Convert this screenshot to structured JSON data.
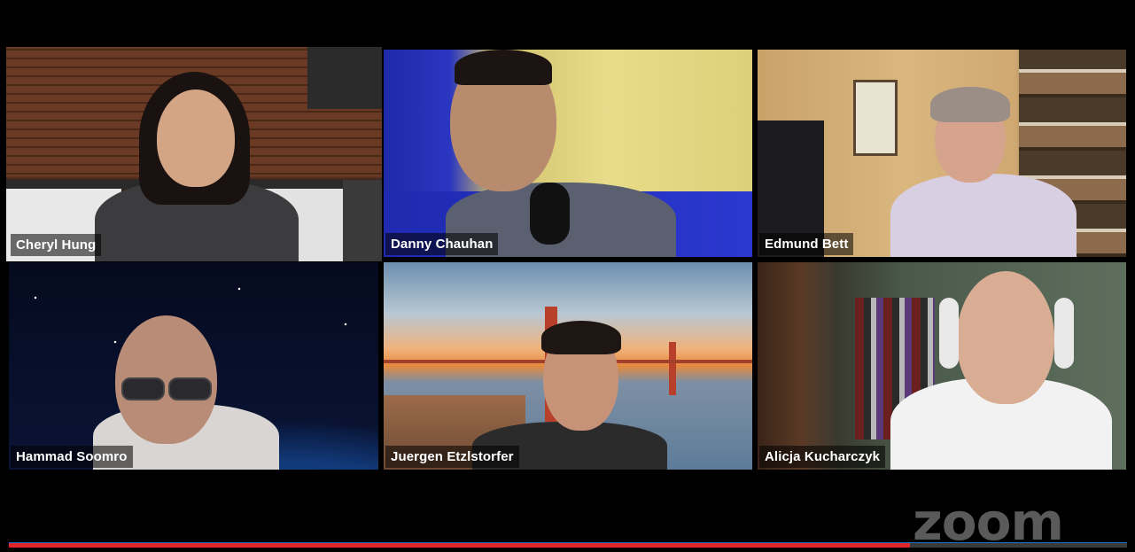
{
  "meeting": {
    "brand": "zoom",
    "accent_color": "#7ed321",
    "active_speaker": "Cheryl Hung",
    "playback_progress": 0.806
  },
  "participants": [
    {
      "name": "Cheryl Hung",
      "background": "brick-kitchen",
      "active": true
    },
    {
      "name": "Danny Chauhan",
      "background": "yellow-wall-blue-couch",
      "active": false
    },
    {
      "name": "Edmund Bett",
      "background": "home-office-bookshelf",
      "active": false
    },
    {
      "name": "Hammad Soomro",
      "background": "earth-from-space",
      "active": false
    },
    {
      "name": "Juergen Etzlstorfer",
      "background": "golden-gate-bridge",
      "active": false
    },
    {
      "name": "Alicja Kucharczyk",
      "background": "room-with-clothes-rack",
      "active": false
    }
  ]
}
